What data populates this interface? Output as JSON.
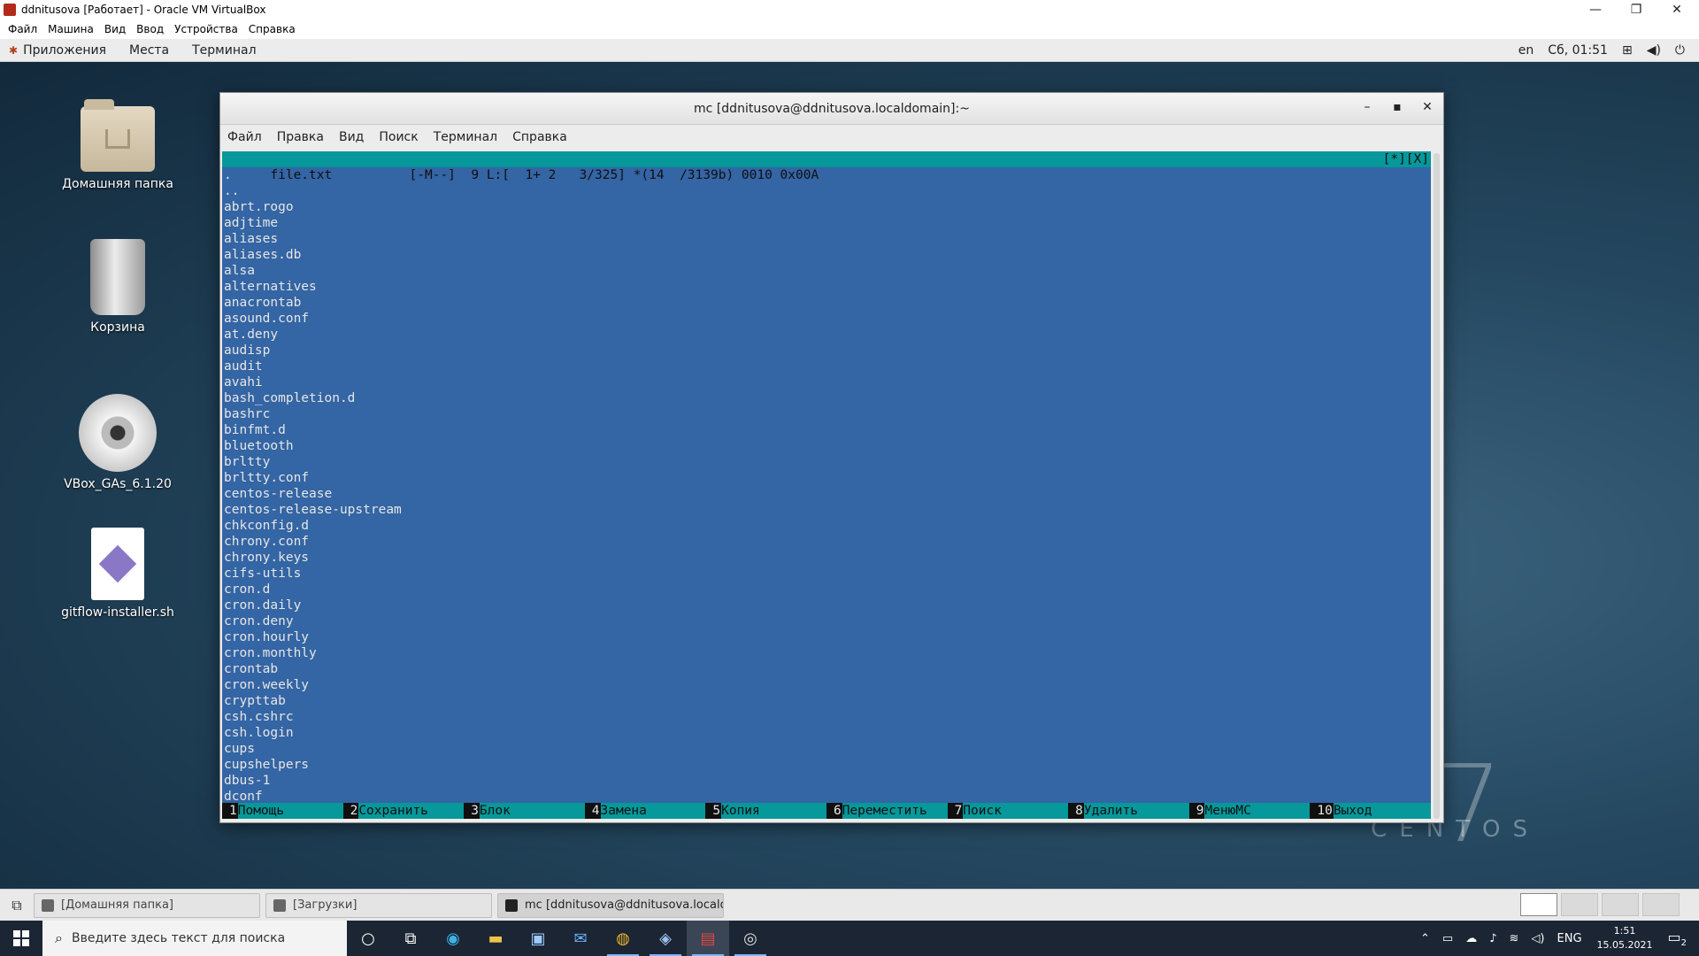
{
  "vbox": {
    "title": "ddnitusova [Работает] - Oracle VM VirtualBox",
    "menu": [
      "Файл",
      "Машина",
      "Вид",
      "Ввод",
      "Устройства",
      "Справка"
    ],
    "controls": [
      "—",
      "❐",
      "✕"
    ]
  },
  "gnome_panel": {
    "apps": "Приложения",
    "places": "Места",
    "terminal": "Терминал",
    "lang": "en",
    "clock": "Сб, 01:51",
    "icons": [
      "network-icon",
      "volume-icon",
      "power-icon"
    ]
  },
  "desktop": {
    "icons": [
      {
        "label": "Домашняя папка",
        "icon": "home-folder-icon"
      },
      {
        "label": "Корзина",
        "icon": "trash-icon"
      },
      {
        "label": "VBox_GAs_6.1.20",
        "icon": "cd-icon"
      },
      {
        "label": "gitflow-installer.sh",
        "icon": "script-file-icon"
      }
    ],
    "brand": "CENTOS",
    "brand_number": "7"
  },
  "terminal": {
    "title": "mc [ddnitusova@ddnitusova.localdomain]:~",
    "menu": [
      "Файл",
      "Правка",
      "Вид",
      "Поиск",
      "Терминал",
      "Справка"
    ],
    "controls": [
      "–",
      "▪",
      "✕"
    ],
    "status_line": "file.txt          [-M--]  9 L:[  1+ 2   3/325] *(14  /3139b) 0010 0x00A",
    "status_right": "[*][X]",
    "lines": [
      ".",
      "..",
      "abrt.rogo",
      "adjtime",
      "aliases",
      "aliases.db",
      "alsa",
      "alternatives",
      "anacrontab",
      "asound.conf",
      "at.deny",
      "audisp",
      "audit",
      "avahi",
      "bash_completion.d",
      "bashrc",
      "binfmt.d",
      "bluetooth",
      "brltty",
      "brltty.conf",
      "centos-release",
      "centos-release-upstream",
      "chkconfig.d",
      "chrony.conf",
      "chrony.keys",
      "cifs-utils",
      "cron.d",
      "cron.daily",
      "cron.deny",
      "cron.hourly",
      "cron.monthly",
      "crontab",
      "cron.weekly",
      "crypttab",
      "csh.cshrc",
      "csh.login",
      "cups",
      "cupshelpers",
      "dbus-1",
      "dconf"
    ],
    "fkeys": [
      {
        "num": "1",
        "label": "Помощь"
      },
      {
        "num": "2",
        "label": "Сохранить"
      },
      {
        "num": "3",
        "label": "Блок"
      },
      {
        "num": "4",
        "label": "Замена"
      },
      {
        "num": "5",
        "label": "Копия"
      },
      {
        "num": "6",
        "label": "Переместить"
      },
      {
        "num": "7",
        "label": "Поиск"
      },
      {
        "num": "8",
        "label": "Удалить"
      },
      {
        "num": "9",
        "label": "МенюMC"
      },
      {
        "num": "10",
        "label": "Выход"
      }
    ]
  },
  "guest_taskbar": {
    "items": [
      {
        "label": "[Домашняя папка]",
        "active": false
      },
      {
        "label": "[Загрузки]",
        "active": false
      },
      {
        "label": "mc [ddnitusova@ddnitusova.localdo...",
        "active": true
      }
    ]
  },
  "win_taskbar": {
    "search_placeholder": "Введите здесь текст для поиска",
    "apps": [
      "cortana-icon",
      "task-view-icon",
      "edge-icon",
      "explorer-icon",
      "store-icon",
      "mail-icon",
      "chrome-icon",
      "virtualbox-icon",
      "virtualbox-vm-icon",
      "obs-icon"
    ],
    "tray": {
      "lang": "ENG",
      "time": "1:51",
      "date": "15.05.2021",
      "notifications": "2"
    }
  }
}
